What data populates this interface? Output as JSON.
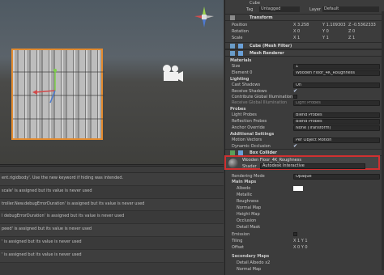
{
  "inspector": {
    "object_name": "Cube",
    "tag_label": "Tag",
    "tag_value": "Untagged",
    "layer_label": "Layer",
    "layer_value": "Default",
    "transform": {
      "title": "Transform",
      "position_label": "Position",
      "position": {
        "x": "X 3.258",
        "y": "Y 1.109303",
        "z": "Z -0.5362333"
      },
      "rotation_label": "Rotation",
      "scale_label": "Scale",
      "rotation": {
        "x": "X 0",
        "y": "Y 0",
        "z": "Z 0"
      },
      "scale": {
        "x": "X 1",
        "y": "Y 1",
        "z": "Z 1"
      }
    },
    "mesh_filter_title": "Cube (Mesh Filter)",
    "mesh_renderer_title": "Mesh Renderer",
    "materials_label": "Materials",
    "size_label": "Size",
    "size_value": "1",
    "element0_label": "Element 0",
    "element0_value": "Wooden Floor_4K_Roughness",
    "lighting_label": "Lighting",
    "cast_shadows_label": "Cast Shadows",
    "cast_shadows_value": "On",
    "receive_shadows_label": "Receive Shadows",
    "contribute_gi_label": "Contribute Global Illumination",
    "receive_gi_label": "Receive Global Illumination",
    "receive_gi_value": "Light Probes",
    "probes_label": "Probes",
    "light_probes_label": "Light Probes",
    "light_probes_value": "Blend Probes",
    "reflection_probes_label": "Reflection Probes",
    "reflection_probes_value": "Blend Probes",
    "anchor_override_label": "Anchor Override",
    "anchor_override_value": "None (Transform)",
    "additional_label": "Additional Settings",
    "motion_vectors_label": "Motion Vectors",
    "motion_vectors_value": "Per Object Motion",
    "dynamic_occlusion_label": "Dynamic Occlusion",
    "box_collider_title": "Box Collider",
    "material_name": "Wooden Floor_4K_Roughness",
    "shader_label": "Shader",
    "shader_value": "Autodesk Interactive",
    "rendering_mode_label": "Rendering Mode",
    "rendering_mode_value": "Opaque",
    "main_maps_label": "Main Maps",
    "albedo_label": "Albedo",
    "metallic_label": "Metallic",
    "roughness_label": "Roughness",
    "normal_map_label": "Normal Map",
    "height_map_label": "Height Map",
    "occlusion_label": "Occlusion",
    "detail_mask_label": "Detail Mask",
    "emission_label": "Emission",
    "tiling_label": "Tiling",
    "tiling_value": "X 1   Y 1",
    "offset_label": "Offset",
    "offset_value": "X 0   Y 0",
    "secondary_maps_label": "Secondary Maps",
    "detail_albedo_label": "Detail Albedo x2",
    "normal_map2_label": "Normal Map"
  },
  "console": {
    "rows": [
      "ent.rigidbody'. Use the new keyword if hiding was intended.",
      "scale' is assigned but its value is never used",
      "troller.New.debugErrorDuration' is assigned but its value is never used",
      "l debugErrorDuration' is assigned but its value is never used",
      "peed' is assigned but its value is never used",
      "' is assigned but its value is never used",
      "' is assigned but its value is never used"
    ]
  },
  "colors": {
    "selection_outline": "#e38b2f",
    "highlight_box": "#d03030"
  }
}
